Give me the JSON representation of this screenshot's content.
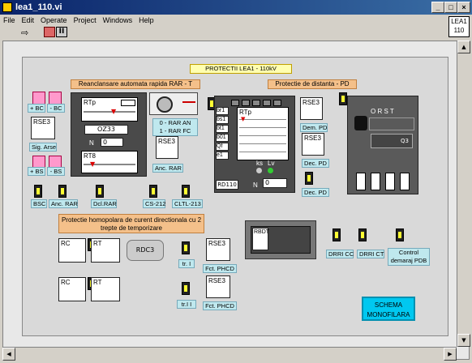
{
  "window": {
    "title": "lea1_110.vi",
    "vi_label_1": "LEA1",
    "vi_label_2": "110"
  },
  "menu": [
    "File",
    "Edit",
    "Operate",
    "Project",
    "Windows",
    "Help"
  ],
  "header": {
    "title": "PROTECTII  LEA1  -  110kV"
  },
  "rar": {
    "title": "Reanclansare automata rapida RAR - T",
    "slider1": "RTp",
    "slider2": "RT8",
    "code": "OZ33",
    "n_label": "N",
    "n_value": "0",
    "mode_text_1": "0 - RAR AN",
    "mode_text_2": "1 - RAR FC",
    "anc_rar": "Anc. RAR",
    "rse": "RSE3"
  },
  "left_controls": {
    "bc": "+ BC",
    "mbc": "- BC",
    "sig": "Sig. Arse",
    "bs": "+ BS",
    "mbs": "- BS",
    "rse": "RSE3"
  },
  "pd": {
    "title": "Protectie de distanta - PD",
    "slider": "RTp",
    "labels": [
      "br1",
      "bs1",
      "bt1",
      "b01",
      "Qf",
      "e1"
    ],
    "rd": "RD110",
    "n_label": "N",
    "n_value": "0",
    "ks": "ks",
    "lv": "Lv",
    "dem": "Dem. PD",
    "dec1": "Dec. PD",
    "dec2": "Dec. PD",
    "rse1": "RSE3",
    "rse2": "RSE3"
  },
  "breaker": {
    "phases": "O   R  S  T",
    "q": "Q3"
  },
  "bottom_row": [
    "BSC",
    "Anc. RAR",
    "Dcl.RAR",
    "CS-212",
    "CLTL-213"
  ],
  "homopolar": {
    "title": "Protectie homopolara de curent directionala cu 2 trepte de temporizare",
    "rc1": "RC",
    "rc2": "RC",
    "rt1": "RT",
    "rt2": "RT",
    "rdc": "RDC3",
    "tr1": "tr. I",
    "tr2": "tr.I I",
    "fct1": "Fct. PHCD",
    "fct2": "Fct. PHCD",
    "rse1": "RSE3",
    "rse2": "RSE3"
  },
  "rbdt": {
    "label": "RBDT"
  },
  "drri": {
    "cc": "DRRI CC",
    "ct": "DRRI CT",
    "control": "Control demaraj PDB"
  },
  "schema": {
    "label": "SCHEMA MONOFILARA"
  }
}
